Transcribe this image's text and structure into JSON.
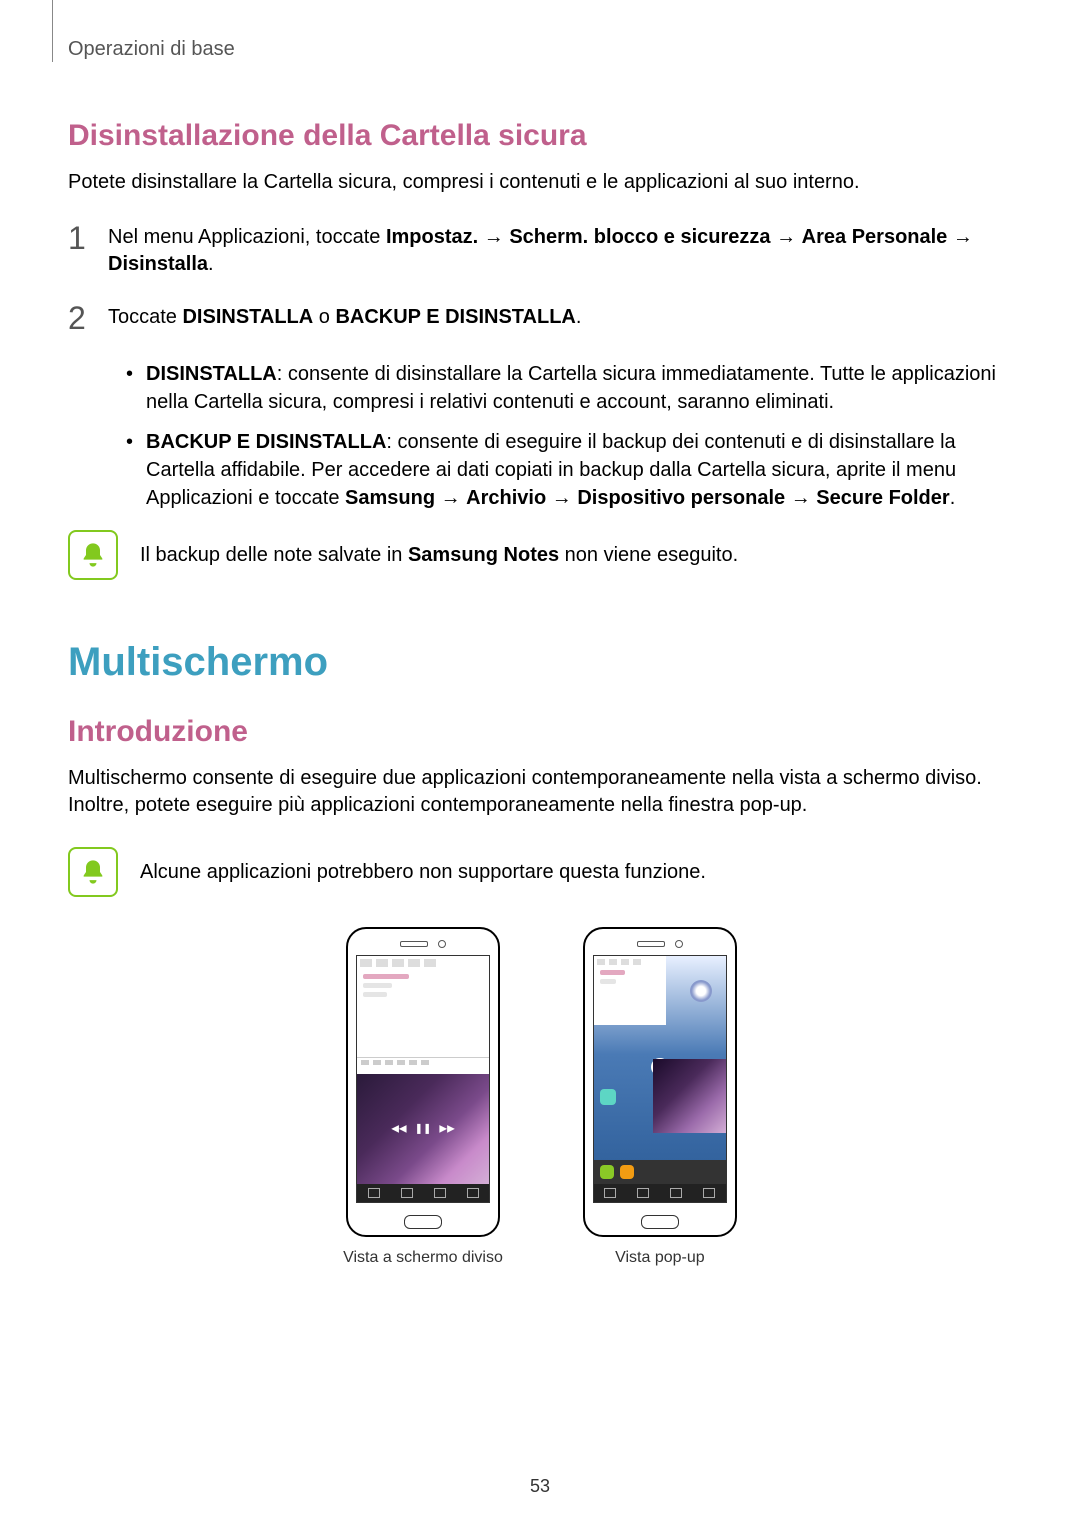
{
  "header": {
    "running_head": "Operazioni di base"
  },
  "section_uninstall": {
    "heading": "Disinstallazione della Cartella sicura",
    "intro": "Potete disinstallare la Cartella sicura, compresi i contenuti e le applicazioni al suo interno.",
    "step1": {
      "num": "1",
      "prefix": "Nel menu Applicazioni, toccate ",
      "b1": "Impostaz.",
      "arrow": " → ",
      "b2": "Scherm. blocco e sicurezza",
      "b3": "Area Personale",
      "b4": "Disinstalla",
      "period": "."
    },
    "step2": {
      "num": "2",
      "prefix": "Toccate ",
      "b1": "DISINSTALLA",
      "or": " o ",
      "b2": "BACKUP E DISINSTALLA",
      "period": "."
    },
    "bullets": {
      "b1_label": "DISINSTALLA",
      "b1_text": ": consente di disinstallare la Cartella sicura immediatamente. Tutte le applicazioni nella Cartella sicura, compresi i relativi contenuti e account, saranno eliminati.",
      "b2_label": "BACKUP E DISINSTALLA",
      "b2_text_a": ": consente di eseguire il backup dei contenuti e di disinstallare la Cartella affidabile. Per accedere ai dati copiati in backup dalla Cartella sicura, aprite il menu Applicazioni e toccate ",
      "b2_s1": "Samsung",
      "b2_s2": "Archivio",
      "b2_s3": "Dispositivo personale",
      "b2_s4": "Secure Folder",
      "b2_period": "."
    },
    "note": {
      "prefix": "Il backup delle note salvate in ",
      "bold": "Samsung Notes",
      "suffix": " non viene eseguito."
    }
  },
  "section_multiscreen": {
    "heading": "Multischermo",
    "subheading": "Introduzione",
    "intro": "Multischermo consente di eseguire due applicazioni contemporaneamente nella vista a schermo diviso. Inoltre, potete eseguire più applicazioni contemporaneamente nella finestra pop-up.",
    "note": "Alcune applicazioni potrebbero non supportare questa funzione.",
    "caption_split": "Vista a schermo diviso",
    "caption_popup": "Vista pop-up"
  },
  "page_number": "53"
}
